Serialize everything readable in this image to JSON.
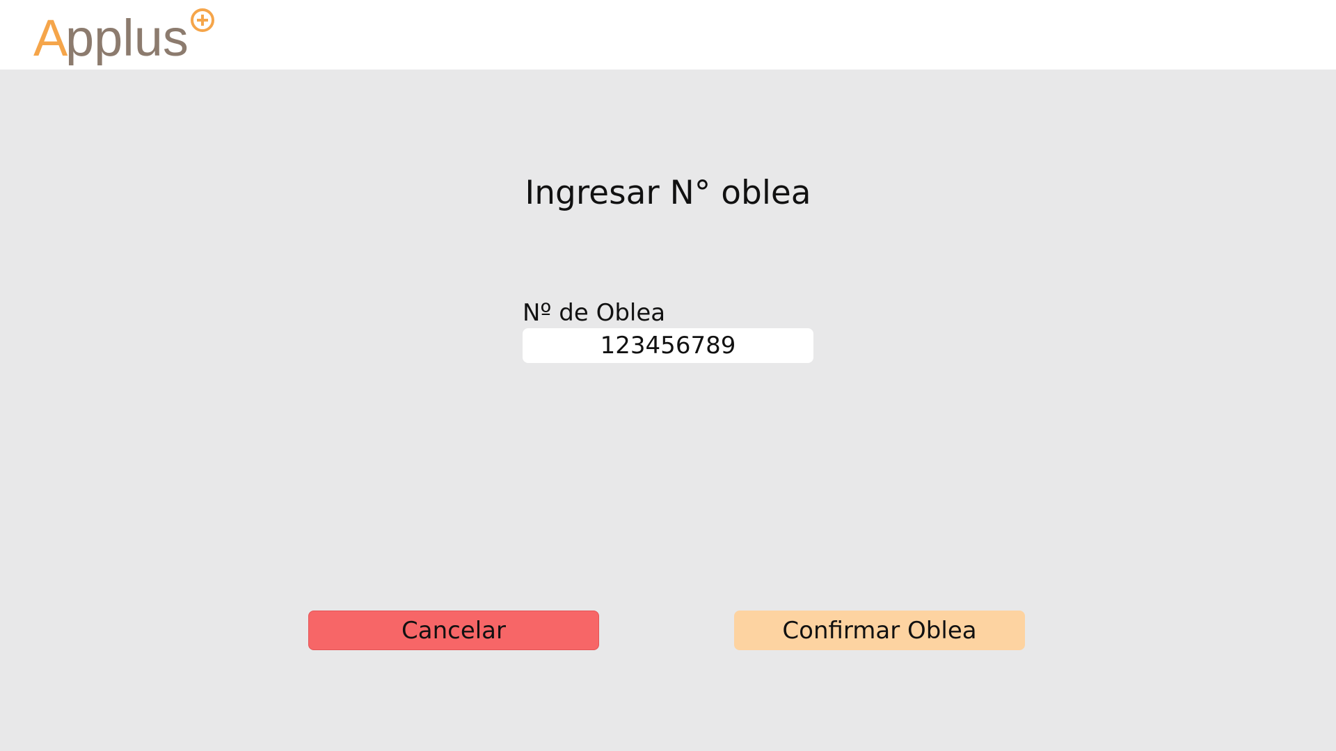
{
  "brand": {
    "logo_text": "Applus",
    "colors": {
      "orange": "#f5a54a",
      "brown": "#8c7b6e"
    }
  },
  "main": {
    "title": "Ingresar N° oblea"
  },
  "form": {
    "label": "Nº de Oblea",
    "value": "123456789"
  },
  "buttons": {
    "cancel_label": "Cancelar",
    "confirm_label": "Confirmar Oblea"
  },
  "colors": {
    "background": "#e8e8e9",
    "header": "#ffffff",
    "cancel": "#f76667",
    "confirm": "#fdd3a1"
  }
}
